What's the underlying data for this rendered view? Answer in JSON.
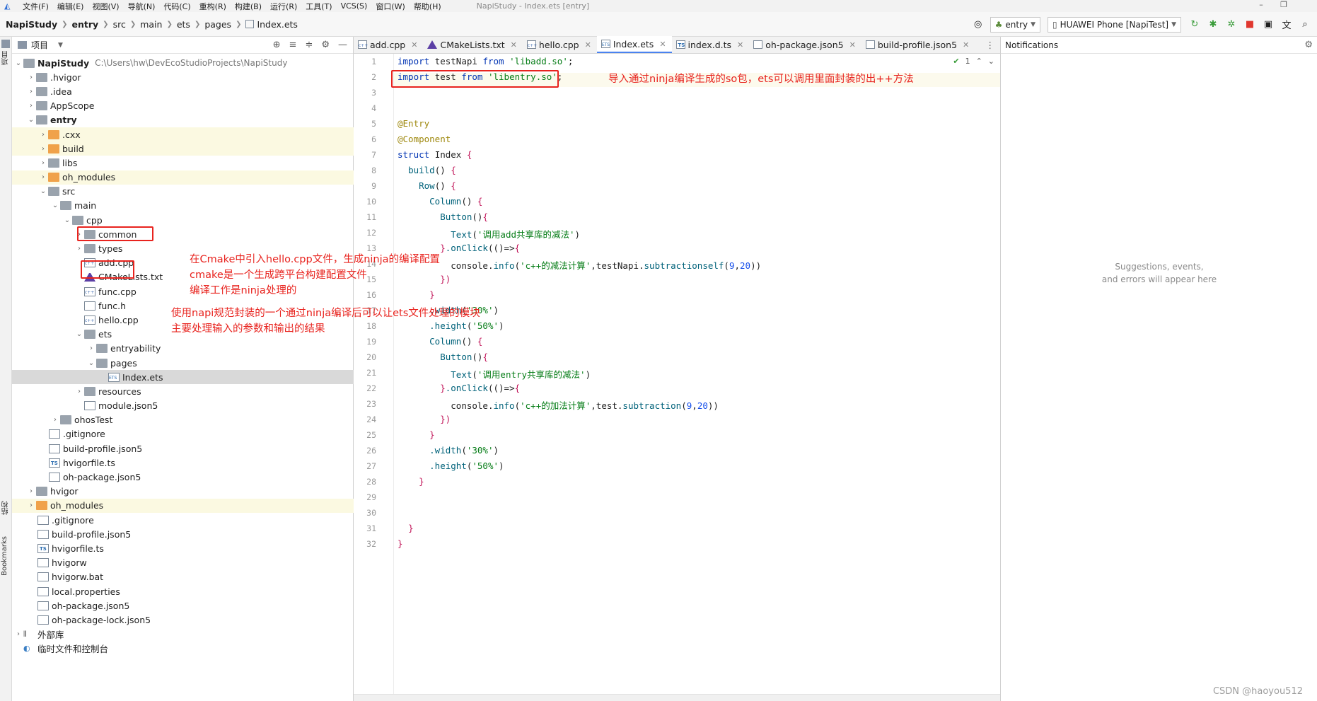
{
  "menubar": {
    "items": [
      "文件(F)",
      "编辑(E)",
      "视图(V)",
      "导航(N)",
      "代码(C)",
      "重构(R)",
      "构建(B)",
      "运行(R)",
      "工具(T)",
      "VCS(S)",
      "窗口(W)",
      "帮助(H)"
    ],
    "window_title": "NapiStudy - Index.ets [entry]"
  },
  "breadcrumb": [
    "NapiStudy",
    "entry",
    "src",
    "main",
    "ets",
    "pages",
    "Index.ets"
  ],
  "toolbar": {
    "module_select": "entry",
    "device_select": "HUAWEI Phone [NapiTest]"
  },
  "side_strip": {
    "top_label": "项目",
    "mid_label": "结构",
    "bottom_label": "Bookmarks"
  },
  "project_panel": {
    "title": "项目",
    "root_path": "C:\\Users\\hw\\DevEcoStudioProjects\\NapiStudy",
    "nodes": [
      {
        "label": "NapiStudy"
      },
      {
        "label": ".hvigor"
      },
      {
        "label": ".idea"
      },
      {
        "label": "AppScope"
      },
      {
        "label": "entry"
      },
      {
        "label": ".cxx"
      },
      {
        "label": "build"
      },
      {
        "label": "libs"
      },
      {
        "label": "oh_modules"
      },
      {
        "label": "src"
      },
      {
        "label": "main"
      },
      {
        "label": "cpp"
      },
      {
        "label": "common"
      },
      {
        "label": "types"
      },
      {
        "label": "add.cpp"
      },
      {
        "label": "CMakeLists.txt"
      },
      {
        "label": "func.cpp"
      },
      {
        "label": "func.h"
      },
      {
        "label": "hello.cpp"
      },
      {
        "label": "ets"
      },
      {
        "label": "entryability"
      },
      {
        "label": "pages"
      },
      {
        "label": "Index.ets"
      },
      {
        "label": "resources"
      },
      {
        "label": "module.json5"
      },
      {
        "label": "ohosTest"
      },
      {
        "label": ".gitignore"
      },
      {
        "label": "build-profile.json5"
      },
      {
        "label": "hvigorfile.ts"
      },
      {
        "label": "oh-package.json5"
      },
      {
        "label": "hvigor"
      },
      {
        "label": "oh_modules"
      },
      {
        "label": ".gitignore"
      },
      {
        "label": "build-profile.json5"
      },
      {
        "label": "hvigorfile.ts"
      },
      {
        "label": "hvigorw"
      },
      {
        "label": "hvigorw.bat"
      },
      {
        "label": "local.properties"
      },
      {
        "label": "oh-package.json5"
      },
      {
        "label": "oh-package-lock.json5"
      },
      {
        "label": "外部库"
      },
      {
        "label": "临时文件和控制台"
      }
    ]
  },
  "tabs": [
    "add.cpp",
    "CMakeLists.txt",
    "hello.cpp",
    "Index.ets",
    "index.d.ts",
    "oh-package.json5",
    "build-profile.json5"
  ],
  "editor": {
    "inspection_count": "1",
    "line_numbers": [
      "1",
      "2",
      "3",
      "4",
      "5",
      "6",
      "7",
      "8",
      "9",
      "10",
      "11",
      "12",
      "13",
      "14",
      "15",
      "16",
      "17",
      "18",
      "19",
      "20",
      "21",
      "22",
      "23",
      "24",
      "25",
      "26",
      "27",
      "28",
      "29",
      "30",
      "31",
      "32"
    ]
  },
  "notifications": {
    "title": "Notifications",
    "empty_line1": "Suggestions, events,",
    "empty_line2": "and errors will appear here"
  },
  "annotations": {
    "import_note": "导入通过ninja编译生成的so包，ets可以调用里面封装的出++方法",
    "cmake_note_1": "在Cmake中引入hello.cpp文件，生成ninja的编译配置",
    "cmake_note_2": "cmake是一个生成跨平台构建配置文件",
    "cmake_note_3": "编译工作是ninja处理的",
    "hello_note_1": "使用napi规范封装的一个通过ninja编译后可以让ets文件处理的模块",
    "hello_note_2": "主要处理输入的参数和输出的结果"
  },
  "watermark": "CSDN @haoyou512"
}
